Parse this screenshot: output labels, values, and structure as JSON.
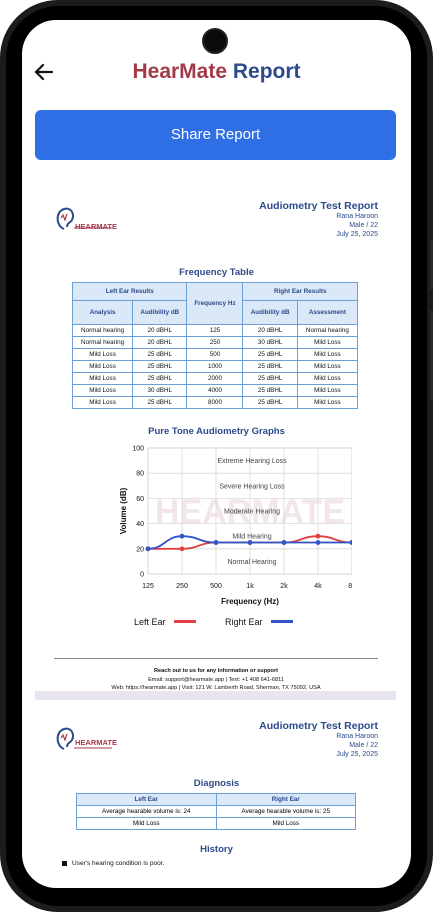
{
  "header": {
    "brand": "HearMate",
    "title_rest": " Report"
  },
  "share_button": "Share Report",
  "report": {
    "logo_text": "HEARMATE",
    "title": "Audiometry Test Report",
    "patient_name": "Rana Haroon",
    "patient_info": "Male / 22",
    "date": "July 25, 2025"
  },
  "frequency_table": {
    "title": "Frequency Table",
    "left_group": "Left Ear Results",
    "right_group": "Right Ear Results",
    "freq_header": "Frequency Hz",
    "col_analysis": "Analysis",
    "col_audibility": "Audibility dB",
    "col_assessment": "Assessment",
    "rows": [
      [
        "Normal hearing",
        "20 dBHL",
        "125",
        "20 dBHL",
        "Normal hearing"
      ],
      [
        "Normal hearing",
        "20 dBHL",
        "250",
        "30 dBHL",
        "Mild Loss"
      ],
      [
        "Mild Loss",
        "25 dBHL",
        "500",
        "25 dBHL",
        "Mild Loss"
      ],
      [
        "Mild Loss",
        "25 dBHL",
        "1000",
        "25 dBHL",
        "Mild Loss"
      ],
      [
        "Mild Loss",
        "25 dBHL",
        "2000",
        "25 dBHL",
        "Mild Loss"
      ],
      [
        "Mild Loss",
        "30 dBHL",
        "4000",
        "25 dBHL",
        "Mild Loss"
      ],
      [
        "Mild Loss",
        "25 dBHL",
        "8000",
        "25 dBHL",
        "Mild Loss"
      ]
    ]
  },
  "chart_data": {
    "type": "line",
    "title": "Pure Tone Audiometry Graphs",
    "xlabel": "Frequency (Hz)",
    "ylabel": "Volume (dB)",
    "categories": [
      "125",
      "250",
      "500",
      "1k",
      "2k",
      "4k",
      "8k"
    ],
    "ylim": [
      0,
      100
    ],
    "yticks": [
      0,
      20,
      40,
      60,
      80,
      100
    ],
    "zones": [
      "Extreme Hearing Loss",
      "Severe Hearing Loss",
      "Moderate Hearing",
      "Mild Hearing",
      "Normal Hearing"
    ],
    "watermark": "HEARMATE",
    "series": [
      {
        "name": "Left Ear",
        "color": "#e04040",
        "values": [
          20,
          20,
          25,
          25,
          25,
          30,
          25
        ]
      },
      {
        "name": "Right Ear",
        "color": "#2f55c8",
        "values": [
          20,
          30,
          25,
          25,
          25,
          25,
          25
        ]
      }
    ],
    "legend_position": "bottom"
  },
  "footer": {
    "line1": "Reach out to us for any information or support",
    "line2": "Email: support@hearmate.app | Text: +1 408 641-6811",
    "line3": "Web: https://hearmate.app | Visit: 121 W. Lamberth Road, Sherman, TX 75092, USA"
  },
  "report2": {
    "diagnosis_title": "Diagnosis",
    "left_label": "Left Ear",
    "right_label": "Right Ear",
    "left_volume": "Average hearable volume is: 24",
    "right_volume": "Average hearable volume is: 25",
    "left_result": "Mild Loss",
    "right_result": "Mild Loss",
    "history_title": "History",
    "history_item": "User's hearing condition is poor."
  },
  "colors": {
    "accent": "#2f6fe6",
    "brand": "#a33a4a",
    "navy": "#2c4a8c"
  }
}
